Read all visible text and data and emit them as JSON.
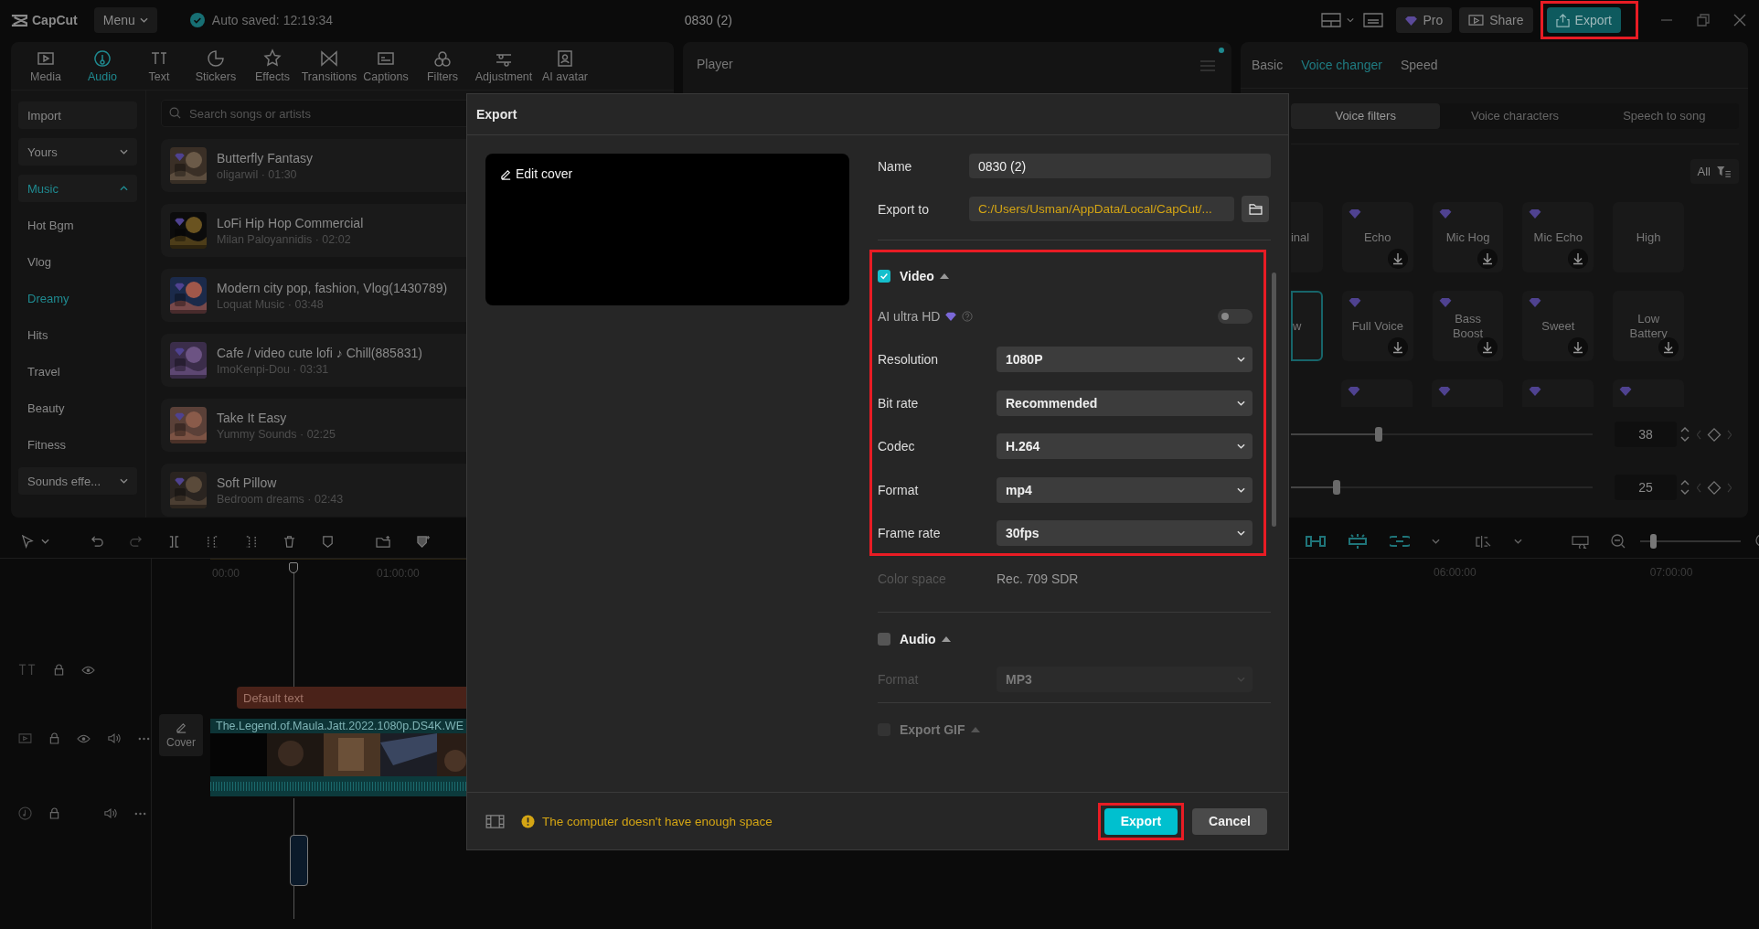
{
  "top_bar": {
    "app_name": "CapCut",
    "menu": "Menu",
    "autosave": "Auto saved: 12:19:34",
    "project_title": "0830 (2)",
    "pro": "Pro",
    "share": "Share",
    "export": {
      "label": "Export",
      "highlighted": true
    }
  },
  "toolbar": [
    {
      "label": "Media",
      "selected": false
    },
    {
      "label": "Audio",
      "selected": true
    },
    {
      "label": "Text",
      "selected": false
    },
    {
      "label": "Stickers",
      "selected": false
    },
    {
      "label": "Effects",
      "selected": false
    },
    {
      "label": "Transitions",
      "selected": false
    },
    {
      "label": "Captions",
      "selected": false
    },
    {
      "label": "Filters",
      "selected": false
    },
    {
      "label": "Adjustment",
      "selected": false
    },
    {
      "label": "AI avatar",
      "selected": false
    }
  ],
  "sidebar": [
    {
      "label": "Import",
      "kind": "button",
      "selected": false
    },
    {
      "label": "Yours",
      "kind": "group",
      "expanded": false,
      "selected": false
    },
    {
      "label": "Music",
      "kind": "group",
      "expanded": true,
      "selected": true
    },
    {
      "label": "Hot Bgm",
      "kind": "item",
      "selected": false
    },
    {
      "label": "Vlog",
      "kind": "item",
      "selected": false
    },
    {
      "label": "Dreamy",
      "kind": "item",
      "selected": true
    },
    {
      "label": "Hits",
      "kind": "item",
      "selected": false
    },
    {
      "label": "Travel",
      "kind": "item",
      "selected": false
    },
    {
      "label": "Beauty",
      "kind": "item",
      "selected": false
    },
    {
      "label": "Fitness",
      "kind": "item",
      "selected": false
    },
    {
      "label": "Sounds effe...",
      "kind": "group",
      "expanded": false,
      "selected": false
    }
  ],
  "search": {
    "placeholder": "Search songs or artists"
  },
  "songs": [
    {
      "title": "Butterfly Fantasy",
      "subtitle": "oligarwil · 01:30"
    },
    {
      "title": "LoFi Hip Hop Commercial",
      "subtitle": "Milan Paloyannidis · 02:02"
    },
    {
      "title": "Modern city pop, fashion, Vlog(1430789)",
      "subtitle": "Loquat Music · 03:48"
    },
    {
      "title": "Cafe / video cute lofi ♪ Chill(885831)",
      "subtitle": "ImoKenpi-Dou · 03:31"
    },
    {
      "title": "Take It Easy",
      "subtitle": "Yummy Sounds · 02:25"
    },
    {
      "title": "Soft Pillow",
      "subtitle": "Bedroom dreams · 02:43"
    }
  ],
  "player": {
    "title": "Player"
  },
  "right_panel": {
    "tabs": [
      {
        "label": "Basic",
        "selected": false
      },
      {
        "label": "Voice changer",
        "selected": true
      },
      {
        "label": "Speed",
        "selected": false
      }
    ],
    "subtabs": [
      {
        "label": "Voice filters",
        "selected": true
      },
      {
        "label": "Voice characters",
        "selected": false
      },
      {
        "label": "Speech to song",
        "selected": false
      }
    ],
    "filter": "All",
    "card_rows": [
      [
        {
          "name": "inal",
          "kind": "clipped",
          "selected": false,
          "pro": false,
          "download": false
        },
        {
          "name": "Echo",
          "kind": "full",
          "selected": false,
          "pro": true,
          "download": true
        },
        {
          "name": "Mic Hog",
          "kind": "full",
          "selected": false,
          "pro": true,
          "download": true
        },
        {
          "name": "Mic Echo",
          "kind": "full",
          "selected": false,
          "pro": true,
          "download": true
        },
        {
          "name": "High",
          "kind": "full",
          "selected": false,
          "pro": false,
          "download": false
        }
      ],
      [
        {
          "name": "w",
          "kind": "clipped",
          "selected": true,
          "pro": false,
          "download": false
        },
        {
          "name": "Full Voice",
          "kind": "full",
          "selected": false,
          "pro": true,
          "download": true
        },
        {
          "name": "Bass Boost",
          "kind": "full",
          "selected": false,
          "pro": true,
          "download": true
        },
        {
          "name": "Sweet",
          "kind": "full",
          "selected": false,
          "pro": true,
          "download": true
        },
        {
          "name": "Low Battery",
          "kind": "full",
          "selected": false,
          "pro": false,
          "download": true
        }
      ],
      [
        {
          "kind": "partial",
          "selected": false,
          "pro": true,
          "download": false
        },
        {
          "kind": "partial",
          "selected": false,
          "pro": true,
          "download": false
        },
        {
          "kind": "partial",
          "selected": false,
          "pro": true,
          "download": false
        },
        {
          "kind": "partial",
          "selected": false,
          "pro": true,
          "download": false
        }
      ]
    ],
    "sliders": [
      {
        "level": 0.29,
        "value": "38"
      },
      {
        "level": 0.15,
        "value": "25"
      }
    ]
  },
  "timeline": {
    "ruler_left": [
      "00:00",
      "01:00:00"
    ],
    "ruler_right": [
      "06:00:00",
      "07:00:00"
    ],
    "text_clip": "Default text",
    "zoom": {
      "level": 0.1
    },
    "video_clip": "The.Legend.of.Maula.Jatt.2022.1080p.DS4K.WE",
    "cover": "Cover"
  },
  "dialog": {
    "title": "Export",
    "edit_cover": "Edit cover",
    "fields": [
      {
        "label": "Name",
        "value": "0830 (2)",
        "kind": "text"
      },
      {
        "label": "Export to",
        "value": "C:/Users/Usman/AppData/Local/CapCut/...",
        "kind": "path"
      }
    ],
    "sections": [
      {
        "title": "Video",
        "checked": true,
        "disabled": false,
        "highlighted": true,
        "rows": [
          {
            "kind": "toggle",
            "label": "AI ultra HD",
            "on": false
          },
          {
            "kind": "select",
            "label": "Resolution",
            "value": "1080P",
            "disabled": false
          },
          {
            "kind": "select",
            "label": "Bit rate",
            "value": "Recommended",
            "disabled": false
          },
          {
            "kind": "select",
            "label": "Codec",
            "value": "H.264",
            "disabled": false
          },
          {
            "kind": "select",
            "label": "Format",
            "value": "mp4",
            "disabled": false
          },
          {
            "kind": "select",
            "label": "Frame rate",
            "value": "30fps",
            "disabled": false
          },
          {
            "kind": "static",
            "label": "Color space",
            "value": "Rec. 709 SDR"
          }
        ]
      },
      {
        "title": "Audio",
        "checked": false,
        "disabled": false,
        "highlighted": false,
        "rows": [
          {
            "kind": "select",
            "label": "Format",
            "value": "MP3",
            "disabled": true
          }
        ]
      },
      {
        "title": "Export GIF",
        "checked": false,
        "disabled": true,
        "highlighted": false
      }
    ],
    "warning": "The computer doesn't have enough space",
    "buttons": [
      {
        "label": "Export",
        "kind": "primary",
        "highlighted": true
      },
      {
        "label": "Cancel",
        "kind": "secondary",
        "highlighted": false
      }
    ]
  }
}
